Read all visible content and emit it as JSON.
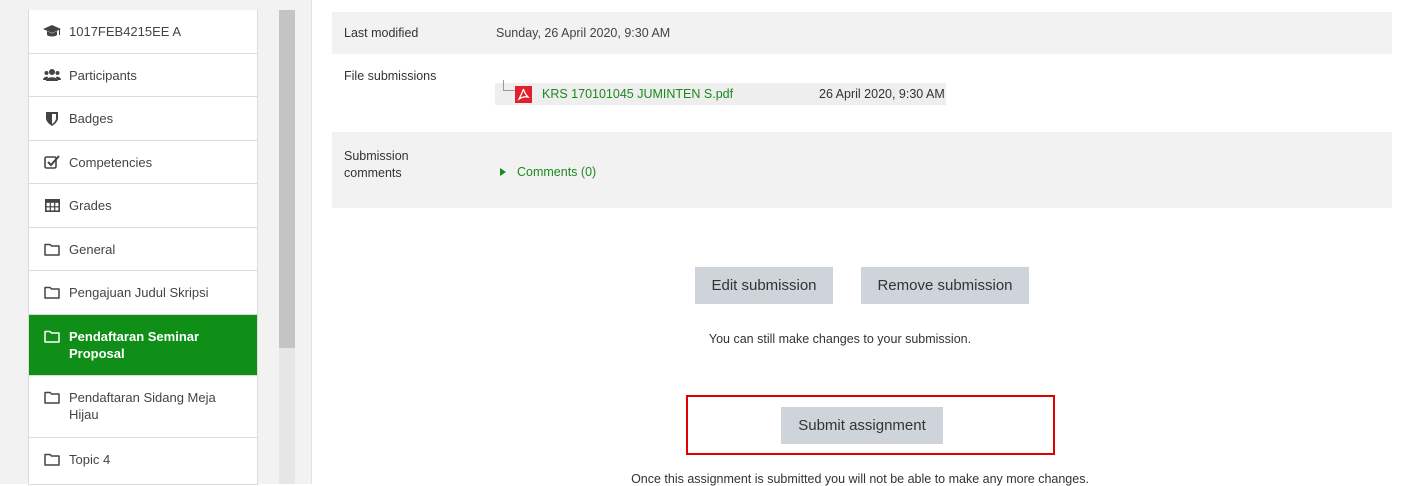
{
  "sidebar": {
    "items": [
      {
        "label": "1017FEB4215EE A",
        "icon": "graduation-cap-icon",
        "active": false
      },
      {
        "label": "Participants",
        "icon": "users-icon",
        "active": false
      },
      {
        "label": "Badges",
        "icon": "shield-icon",
        "active": false
      },
      {
        "label": "Competencies",
        "icon": "checkbox-icon",
        "active": false
      },
      {
        "label": "Grades",
        "icon": "table-icon",
        "active": false
      },
      {
        "label": "General",
        "icon": "folder-icon",
        "active": false
      },
      {
        "label": "Pengajuan Judul Skripsi",
        "icon": "folder-icon",
        "active": false
      },
      {
        "label": "Pendaftaran Seminar Proposal",
        "icon": "folder-icon",
        "active": true
      },
      {
        "label": "Pendaftaran Sidang Meja Hijau",
        "icon": "folder-icon",
        "active": false
      },
      {
        "label": "Topic 4",
        "icon": "folder-icon",
        "active": false
      }
    ]
  },
  "status": {
    "last_modified_label": "Last modified",
    "last_modified_value": "Sunday, 26 April 2020, 9:30 AM",
    "file_submissions_label": "File submissions",
    "file_name": "KRS 170101045 JUMINTEN S.pdf",
    "file_date": "26 April 2020, 9:30 AM",
    "submission_comments_label": "Submission comments",
    "comments_link": "Comments (0)"
  },
  "actions": {
    "edit_label": "Edit submission",
    "remove_label": "Remove submission",
    "edit_note": "You can still make changes to your submission.",
    "submit_label": "Submit assignment",
    "submit_note": "Once this assignment is submitted you will not be able to make any more changes."
  },
  "colors": {
    "active": "#0f8f17",
    "link": "#1a8a1a",
    "button": "#ced4da",
    "highlight": "#e00000"
  }
}
